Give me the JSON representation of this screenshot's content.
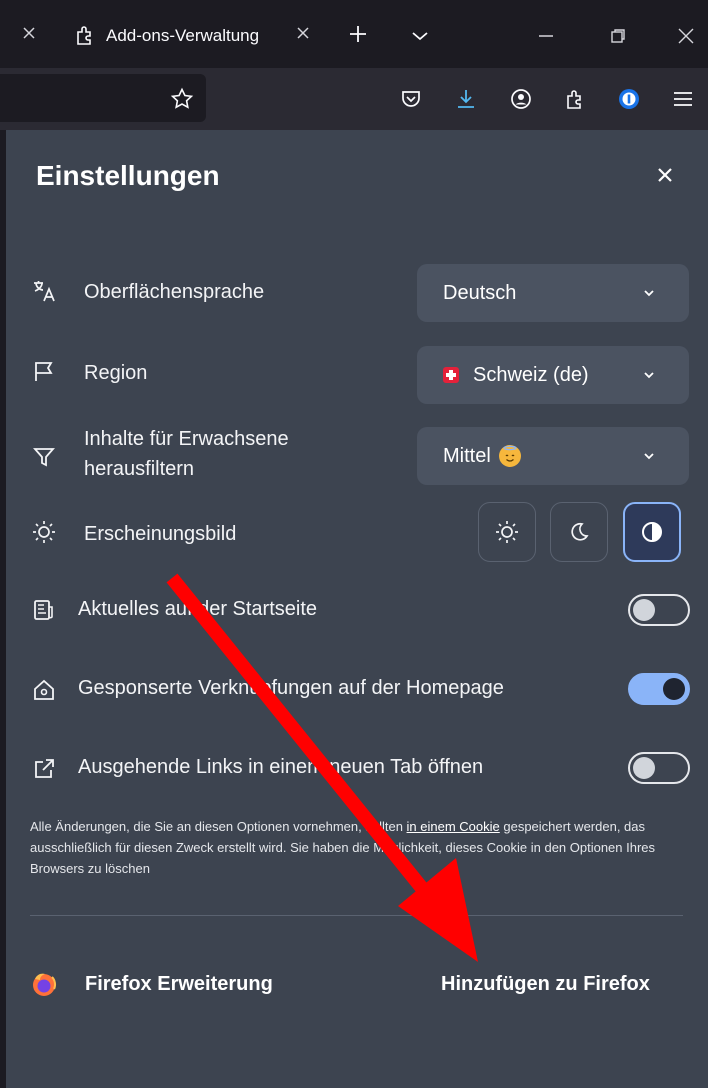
{
  "browser": {
    "tab_title": "Add-ons-Verwaltung"
  },
  "settings": {
    "title": "Einstellungen",
    "rows": {
      "language": {
        "label": "Oberflächensprache",
        "value": "Deutsch"
      },
      "region": {
        "label": "Region",
        "value": "Schweiz (de)"
      },
      "filter": {
        "label_line1": "Inhalte für Erwachsene",
        "label_line2": "herausfiltern",
        "value": "Mittel"
      },
      "appearance": {
        "label": "Erscheinungsbild",
        "options": [
          "light",
          "dark",
          "system"
        ],
        "selected": "system"
      },
      "news": {
        "label": "Aktuelles auf der Startseite",
        "enabled": false
      },
      "sponsored": {
        "label": "Gesponserte Verknüpfungen auf der Homepage",
        "enabled": true
      },
      "newtab": {
        "label": "Ausgehende Links in einem neuen Tab öffnen",
        "enabled": false
      }
    },
    "note": {
      "part1": "Alle Änderungen, die Sie an diesen Optionen vornehmen, sollten ",
      "link": "in einem Cookie",
      "part2": " gespeichert werden, das ausschließlich für diesen Zweck erstellt wird. Sie haben die Möglichkeit, dieses Cookie in den Optionen Ihres Browsers zu löschen"
    },
    "extension": {
      "label": "Firefox Erweiterung",
      "action": "Hinzufügen zu Firefox"
    }
  },
  "colors": {
    "panel_bg": "#3d4450",
    "accent": "#8ab4f8",
    "annotation_arrow": "#ff0000"
  }
}
